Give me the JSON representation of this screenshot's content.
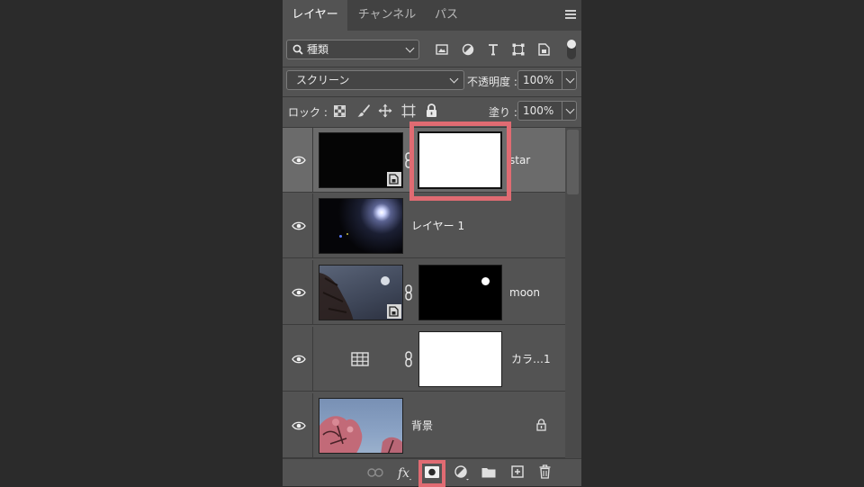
{
  "tabs": [
    "レイヤー",
    "チャンネル",
    "パス"
  ],
  "filter": {
    "label": "種類"
  },
  "blend": {
    "mode": "スクリーン",
    "opacity_label": "不透明度 :",
    "opacity": "100%"
  },
  "lock": {
    "label": "ロック :",
    "fill_label": "塗り :",
    "fill": "100%"
  },
  "layers": [
    {
      "name": "star",
      "selected": true
    },
    {
      "name": "レイヤー 1"
    },
    {
      "name": "moon"
    },
    {
      "name": "カラ…1"
    },
    {
      "name": "背景"
    }
  ],
  "highlight_color": "#e06b72"
}
